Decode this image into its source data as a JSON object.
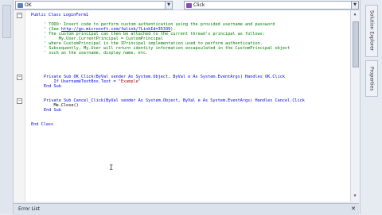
{
  "combos": {
    "class_name": "OK",
    "method_name": "Click"
  },
  "right_panel": {
    "tab1": "Solution Explorer",
    "tab2": "Properties"
  },
  "code": {
    "lines": [
      {
        "k": "Public Class LoginForm1"
      },
      {
        "c": "' TODO: Insert code to perform custom authentication using the provided username and password"
      },
      {
        "c": "' (See ",
        "u": "http://go.microsoft.com/fwlink/?LinkId=35339",
        "c2": ")."
      },
      {
        "c": "' The custom principal can then be attached to the current thread's principal as follows:"
      },
      {
        "c": "'     My.User.CurrentPrincipal = CustomPrincipal"
      },
      {
        "c": "' where CustomPrincipal is the IPrincipal implementation used to perform authentication."
      },
      {
        "c": "' Subsequently, My.User will return identity information encapsulated in the CustomPrincipal object"
      },
      {
        "c": "' such as the username, display name, etc."
      },
      {
        "blank": ""
      },
      {
        "k": "Private Sub OK_Click(ByVal sender As System.Object, ByVal e As System.EventArgs) Handles OK.Click"
      },
      {
        "k": "    If UsernameTextBox.Text = ",
        "s": "\"Example\""
      },
      {
        "k": "End Sub"
      },
      {
        "blank": ""
      },
      {
        "k": "Private Sub Cancel_Click(ByVal sender As System.Object, ByVal e As System.EventArgs) Handles Cancel.Click"
      },
      {
        "k": "    Me.Close()"
      },
      {
        "k": "End Sub"
      },
      {
        "blank": ""
      },
      {
        "k": "End Class"
      }
    ]
  },
  "status": {
    "text": "Error List"
  }
}
